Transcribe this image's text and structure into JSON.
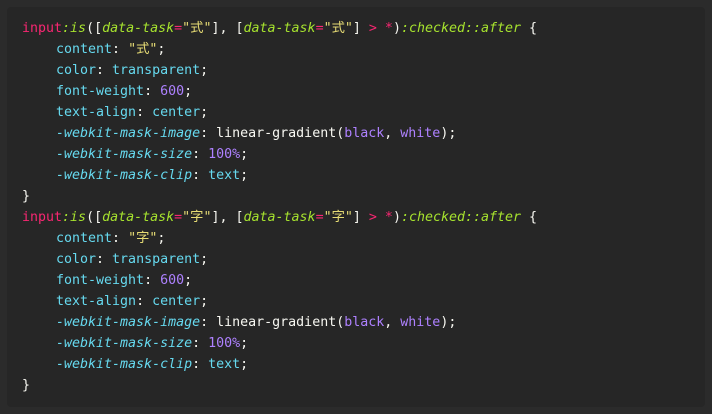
{
  "code": {
    "line1": {
      "tag": "input",
      "pseudo_is": ":is",
      "p1": "([",
      "attr1": "data-task",
      "eq1": "=",
      "str1": "\"式\"",
      "p2": "], [",
      "attr2": "data-task",
      "eq2": "=",
      "str2": "\"式\"",
      "p3": "] ",
      "op": "> *",
      "p4": ")",
      "pseudo_checked": ":checked",
      "pseudo_after": "::after",
      "brace": " {"
    },
    "line2": {
      "prop": "content",
      "colon": ": ",
      "value": "\"式\"",
      "semi": ";"
    },
    "line3": {
      "prop": "color",
      "colon": ": ",
      "value": "transparent",
      "semi": ";"
    },
    "line4": {
      "prop": "font-weight",
      "colon": ": ",
      "value": "600",
      "semi": ";"
    },
    "line5": {
      "prop": "text-align",
      "colon": ": ",
      "value": "center",
      "semi": ";"
    },
    "line6": {
      "prop": "-webkit-mask-image",
      "colon": ": ",
      "fn": "linear-gradient",
      "open": "(",
      "a1": "black",
      "comma": ", ",
      "a2": "white",
      "close": ");"
    },
    "line7": {
      "prop": "-webkit-mask-size",
      "colon": ": ",
      "value": "100%",
      "semi": ";"
    },
    "line8": {
      "prop": "-webkit-mask-clip",
      "colon": ": ",
      "value": "text",
      "semi": ";"
    },
    "line9": {
      "brace": "}"
    },
    "line10": {
      "tag": "input",
      "pseudo_is": ":is",
      "p1": "([",
      "attr1": "data-task",
      "eq1": "=",
      "str1": "\"字\"",
      "p2": "], [",
      "attr2": "data-task",
      "eq2": "=",
      "str2": "\"字\"",
      "p3": "] ",
      "op": "> *",
      "p4": ")",
      "pseudo_checked": ":checked",
      "pseudo_after": "::after",
      "brace": " {"
    },
    "line11": {
      "prop": "content",
      "colon": ": ",
      "value": "\"字\"",
      "semi": ";"
    },
    "line12": {
      "prop": "color",
      "colon": ": ",
      "value": "transparent",
      "semi": ";"
    },
    "line13": {
      "prop": "font-weight",
      "colon": ": ",
      "value": "600",
      "semi": ";"
    },
    "line14": {
      "prop": "text-align",
      "colon": ": ",
      "value": "center",
      "semi": ";"
    },
    "line15": {
      "prop": "-webkit-mask-image",
      "colon": ": ",
      "fn": "linear-gradient",
      "open": "(",
      "a1": "black",
      "comma": ", ",
      "a2": "white",
      "close": ");"
    },
    "line16": {
      "prop": "-webkit-mask-size",
      "colon": ": ",
      "value": "100%",
      "semi": ";"
    },
    "line17": {
      "prop": "-webkit-mask-clip",
      "colon": ": ",
      "value": "text",
      "semi": ";"
    },
    "line18": {
      "brace": "}"
    }
  }
}
